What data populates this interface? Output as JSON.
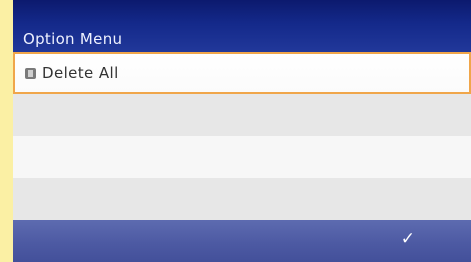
{
  "header": {
    "title": "Option Menu"
  },
  "menu": {
    "items": [
      {
        "label": "Delete All",
        "icon": "trash-icon",
        "selected": true
      }
    ]
  },
  "footer": {
    "confirm_icon": "checkmark-icon",
    "confirm_glyph": "✓"
  },
  "colors": {
    "title_bar": "#14298a",
    "selection_border": "#f0a64a",
    "bottom_bar": "#4d5aa3",
    "frame": "#fbf0a4"
  }
}
